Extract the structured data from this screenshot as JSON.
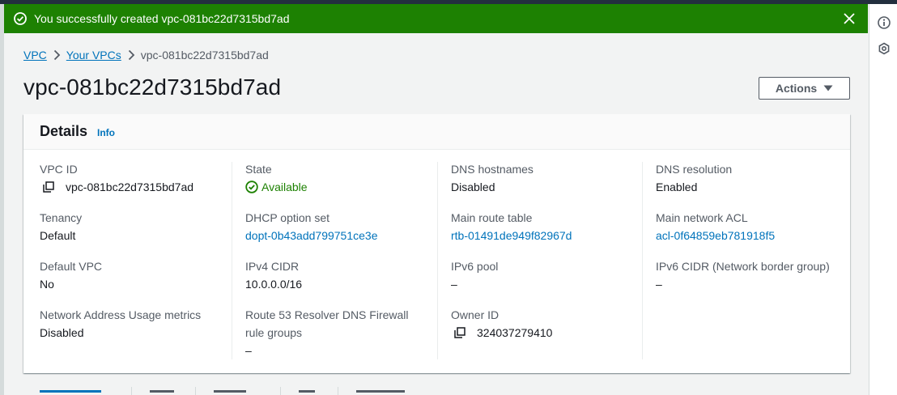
{
  "flash": {
    "message": "You successfully created vpc-081bc22d7315bd7ad",
    "type": "success",
    "color": "#1d8102"
  },
  "breadcrumbs": [
    {
      "label": "VPC"
    },
    {
      "label": "Your VPCs"
    },
    {
      "label": "vpc-081bc22d7315bd7ad"
    }
  ],
  "page": {
    "title": "vpc-081bc22d7315bd7ad",
    "actions_label": "Actions"
  },
  "details": {
    "title": "Details",
    "info_label": "Info",
    "columns": [
      [
        {
          "label": "VPC ID",
          "value": "vpc-081bc22d7315bd7ad",
          "copyable": true
        },
        {
          "label": "Tenancy",
          "value": "Default"
        },
        {
          "label": "Default VPC",
          "value": "No"
        },
        {
          "label": "Network Address Usage metrics",
          "value": "Disabled"
        }
      ],
      [
        {
          "label": "State",
          "value": "Available",
          "status": "success"
        },
        {
          "label": "DHCP option set",
          "value": "dopt-0b43add799751ce3e",
          "link": true
        },
        {
          "label": "IPv4 CIDR",
          "value": "10.0.0.0/16"
        },
        {
          "label": "Route 53 Resolver DNS Firewall rule groups",
          "value": "–"
        }
      ],
      [
        {
          "label": "DNS hostnames",
          "value": "Disabled"
        },
        {
          "label": "Main route table",
          "value": "rtb-01491de949f82967d",
          "link": true
        },
        {
          "label": "IPv6 pool",
          "value": "–"
        },
        {
          "label": "Owner ID",
          "value": "324037279410",
          "copyable": true
        }
      ],
      [
        {
          "label": "DNS resolution",
          "value": "Enabled"
        },
        {
          "label": "Main network ACL",
          "value": "acl-0f64859eb781918f5",
          "link": true
        },
        {
          "label": "IPv6 CIDR (Network border group)",
          "value": "–"
        }
      ]
    ]
  },
  "right_rail": {
    "icons": [
      "info-circle-icon",
      "settings-hex-icon"
    ]
  },
  "colors": {
    "link": "#0073bb",
    "success": "#1d8102",
    "header_bar": "#232f3e"
  }
}
